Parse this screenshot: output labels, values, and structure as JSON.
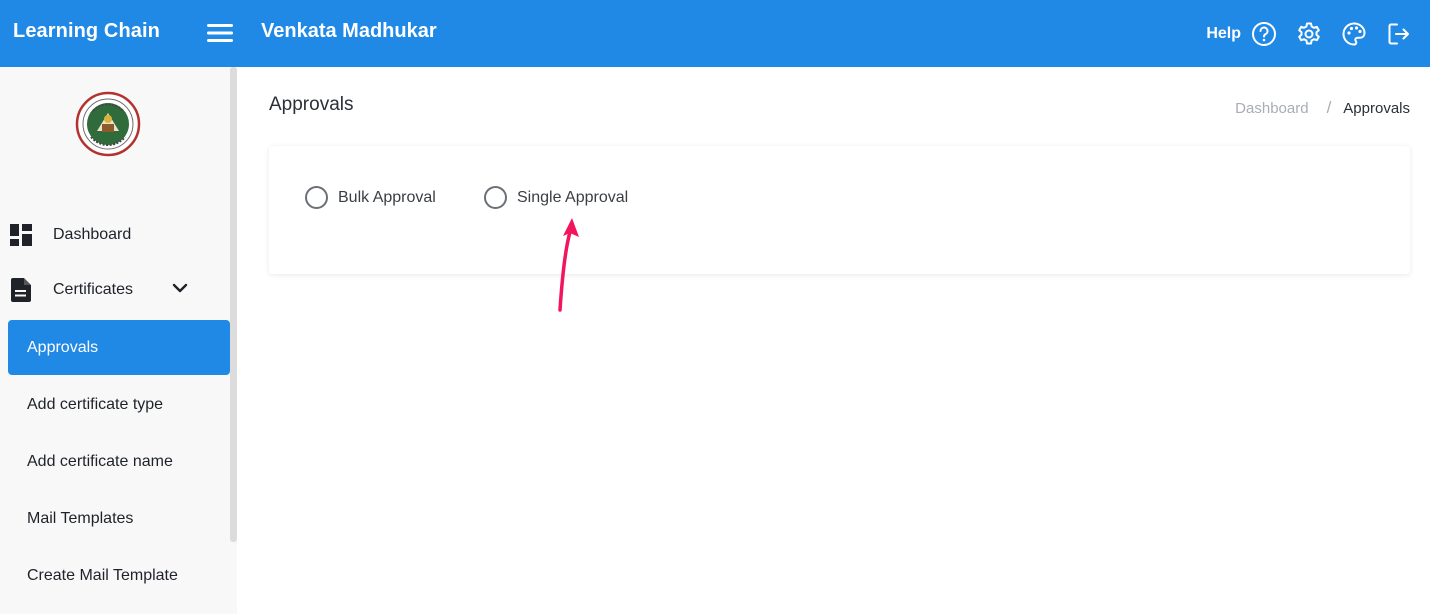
{
  "header": {
    "brand": "Learning Chain",
    "user_name": "Venkata Madhukar",
    "help_label": "Help",
    "icons": [
      "menu-icon",
      "help-circle-icon",
      "settings-gear-icon",
      "palette-icon",
      "logout-icon"
    ]
  },
  "sidebar": {
    "logo_icon": "university-seal-logo",
    "items": [
      {
        "label": "Dashboard",
        "icon": "dashboard-grid-icon"
      },
      {
        "label": "Certificates",
        "icon": "document-icon",
        "expanded": true
      }
    ],
    "sub_items": [
      {
        "label": "Approvals",
        "active": true
      },
      {
        "label": "Add certificate type",
        "active": false
      },
      {
        "label": "Add certificate name",
        "active": false
      },
      {
        "label": "Mail Templates",
        "active": false
      },
      {
        "label": "Create Mail Template",
        "active": false
      }
    ]
  },
  "main": {
    "title": "Approvals",
    "breadcrumb": {
      "root": "Dashboard",
      "separator": "/",
      "current": "Approvals"
    },
    "options": [
      {
        "label": "Bulk Approval",
        "selected": false
      },
      {
        "label": "Single Approval",
        "selected": false
      }
    ],
    "annotation": {
      "type": "arrow",
      "color": "#f2155d",
      "points_to": "Single Approval"
    }
  },
  "colors": {
    "primary": "#2089e6",
    "sidebar_bg": "#f8f8f8",
    "annotation_arrow": "#f2155d"
  }
}
